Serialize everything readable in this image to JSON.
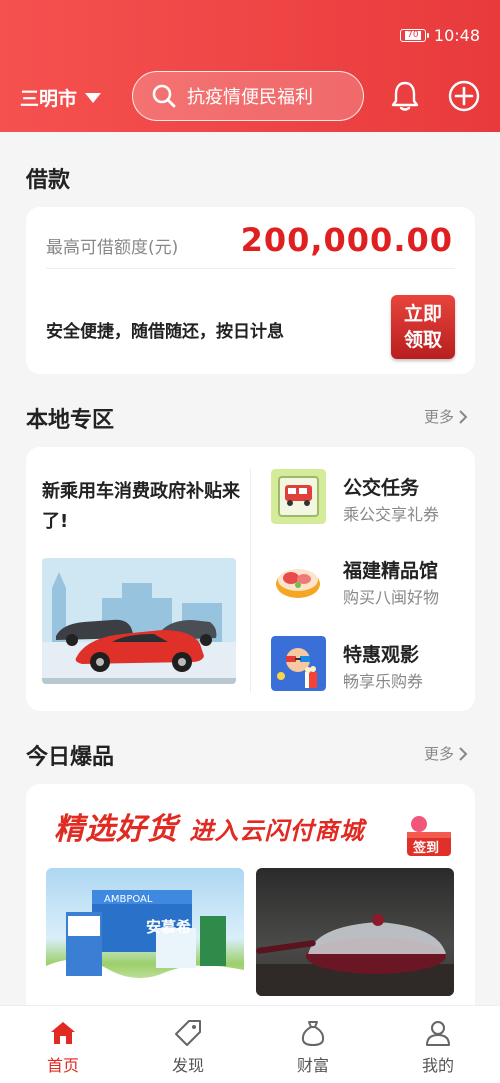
{
  "status": {
    "battery": "70",
    "time": "10:48"
  },
  "header": {
    "city": "三明市",
    "search_placeholder": "抗疫情便民福利"
  },
  "loan": {
    "title": "借款",
    "limit_label": "最高可借额度(元)",
    "limit_amount": "200,000.00",
    "slogan": "安全便捷，随借随还，按日计息",
    "button_line1": "立即",
    "button_line2": "领取"
  },
  "local": {
    "title": "本地专区",
    "more": "更多",
    "promo_text": "新乘用车消费政府补贴来了!",
    "services": [
      {
        "title": "公交任务",
        "sub": "乘公交享礼券"
      },
      {
        "title": "福建精品馆",
        "sub": "购买八闽好物"
      },
      {
        "title": "特惠观影",
        "sub": "畅享乐购券"
      }
    ]
  },
  "hot": {
    "title": "今日爆品",
    "more": "更多",
    "banner_a": "精选好货",
    "banner_b": "进入云闪付商城",
    "signin": "签到",
    "product1_brand": "安慕希",
    "product1_brand2": "AMBPOAL"
  },
  "nav": [
    {
      "label": "首页",
      "active": true
    },
    {
      "label": "发现",
      "active": false
    },
    {
      "label": "财富",
      "active": false
    },
    {
      "label": "我的",
      "active": false
    }
  ],
  "colors": {
    "brand_red": "#e83a3c",
    "amount_red": "#e02020"
  }
}
